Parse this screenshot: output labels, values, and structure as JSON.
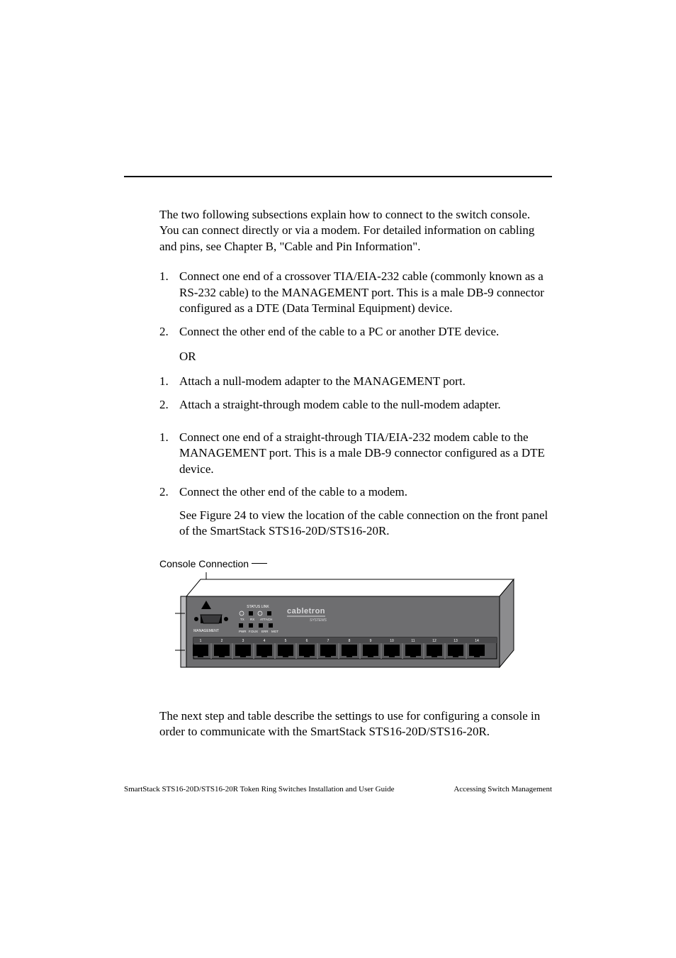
{
  "intro": "The two following subsections explain how to connect to the switch console. You can connect directly or via a modem. For detailed information on cabling and pins, see Chapter B, \"Cable and Pin Information\".",
  "direct": {
    "step1": "Connect one end of a crossover TIA/EIA-232 cable (commonly known as a RS-232 cable) to the MANAGEMENT port. This is a male DB-9 connector configured as a DTE (Data Terminal Equipment) device.",
    "step2": "Connect the other end of the cable to a PC or another DTE device.",
    "or": "OR",
    "alt1": "Attach a null-modem adapter to the MANAGEMENT port.",
    "alt2": "Attach a straight-through modem cable to the null-modem adapter."
  },
  "modem": {
    "step1": "Connect one end of a straight-through TIA/EIA-232 modem cable to the MANAGEMENT port. This is a male DB-9 connector configured as a DTE device.",
    "step2": "Connect the other end of the cable to a modem.",
    "seefig": "See Figure 24 to view the location of the cable connection on the front panel of the SmartStack STS16-20D/STS16-20R."
  },
  "figure": {
    "callout": "Console Connection",
    "brand": "cabletron",
    "brand_sub": "SYSTEMS",
    "panel": {
      "status_link": "STATUS LINK",
      "tx": "TX",
      "rx": "RX",
      "attach": "ATTACH",
      "management": "MANAGEMENT",
      "pwr": "PWR",
      "fdx": "F.DUX",
      "err": "ERR",
      "mgt": "MGT",
      "ports": [
        "1",
        "2",
        "3",
        "4",
        "5",
        "6",
        "7",
        "8",
        "9",
        "10",
        "11",
        "12",
        "13",
        "14"
      ]
    }
  },
  "closing": "The next step and table describe the settings to use for configuring a console in order to communicate with the SmartStack STS16-20D/STS16-20R.",
  "footer_left": "SmartStack STS16-20D/STS16-20R Token Ring Switches Installation and User Guide",
  "footer_right": "Accessing Switch Management"
}
